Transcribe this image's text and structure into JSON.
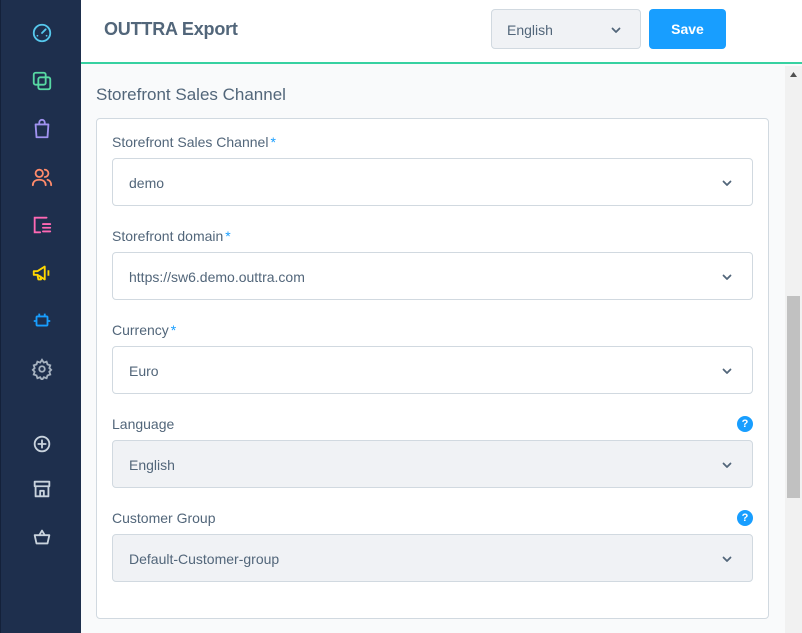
{
  "app": {
    "title": "OUTTRA Export"
  },
  "header": {
    "language_value": "English",
    "save_label": "Save"
  },
  "sidebar": {
    "items": [
      {
        "name": "dashboard-icon",
        "color": "#56c8ed"
      },
      {
        "name": "catalog-icon",
        "color": "#57d9a3"
      },
      {
        "name": "orders-icon",
        "color": "#a092f0"
      },
      {
        "name": "customers-icon",
        "color": "#ff8b6b"
      },
      {
        "name": "content-icon",
        "color": "#ff68b4"
      },
      {
        "name": "marketing-icon",
        "color": "#ffd700"
      },
      {
        "name": "extensions-icon",
        "color": "#189eff"
      },
      {
        "name": "settings-icon",
        "color": "#a5b1bf"
      },
      {
        "name": "add-sales-channel-icon",
        "color": "#c9d3dd"
      },
      {
        "name": "storefront-icon",
        "color": "#c9d3dd"
      },
      {
        "name": "basket-icon",
        "color": "#c9d3dd"
      }
    ]
  },
  "section": {
    "title": "Storefront Sales Channel",
    "fields": [
      {
        "label": "Storefront Sales Channel",
        "required_mark": "*",
        "value": "demo"
      },
      {
        "label": "Storefront domain",
        "required_mark": "*",
        "value": "https://sw6.demo.outtra.com"
      },
      {
        "label": "Currency",
        "required_mark": "*",
        "value": "Euro"
      },
      {
        "label": "Language",
        "value": "English",
        "help": "?"
      },
      {
        "label": "Customer Group",
        "value": "Default-Customer-group",
        "help": "?"
      }
    ]
  },
  "colors": {
    "accent": "#189eff",
    "header_border": "#37d1a1",
    "sidebar_bg": "#1e2f4d"
  }
}
